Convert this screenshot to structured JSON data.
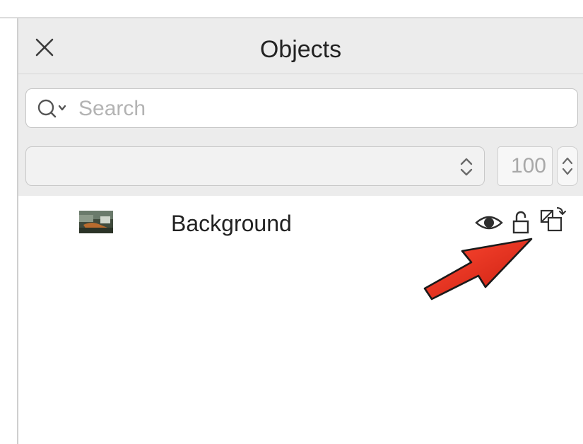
{
  "panel": {
    "title": "Objects",
    "close_icon": "close-icon"
  },
  "search": {
    "placeholder": "Search",
    "value": "",
    "icon": "search-icon"
  },
  "controls": {
    "blend_mode": "",
    "opacity": "100"
  },
  "layers": [
    {
      "name": "Background",
      "thumbnail": "image-thumbnail",
      "icons": [
        "eye-icon",
        "lock-icon",
        "copy-icon"
      ]
    }
  ],
  "annotation": {
    "arrow_color": "#e02b1c"
  },
  "colors": {
    "header_bg": "#ececec",
    "panel_bg": "#ffffff"
  }
}
